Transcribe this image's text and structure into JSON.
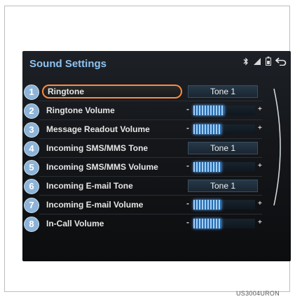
{
  "screen": {
    "title": "Sound Settings",
    "status_icons": [
      "bluetooth-icon",
      "signal-icon",
      "battery-icon",
      "back-icon"
    ],
    "accent_color": "#8fc3f0",
    "focus_color": "#ff8a40"
  },
  "items": [
    {
      "number": "1",
      "label": "Ringtone",
      "type": "tone",
      "value": "Tone 1",
      "focused": true
    },
    {
      "number": "2",
      "label": "Ringtone Volume",
      "type": "volume",
      "minus": "-",
      "plus": "+",
      "level": 0.5
    },
    {
      "number": "3",
      "label": "Message Readout Volume",
      "type": "volume",
      "minus": "-",
      "plus": "+",
      "level": 0.45
    },
    {
      "number": "4",
      "label": "Incoming SMS/MMS Tone",
      "type": "tone",
      "value": "Tone 1"
    },
    {
      "number": "5",
      "label": "Incoming SMS/MMS Volume",
      "type": "volume",
      "minus": "-",
      "plus": "+",
      "level": 0.45
    },
    {
      "number": "6",
      "label": "Incoming E-mail Tone",
      "type": "tone",
      "value": "Tone 1"
    },
    {
      "number": "7",
      "label": "Incoming E-mail Volume",
      "type": "volume",
      "minus": "-",
      "plus": "+",
      "level": 0.45
    },
    {
      "number": "8",
      "label": "In-Call Volume",
      "type": "volume",
      "minus": "-",
      "plus": "+",
      "level": 0.45
    }
  ],
  "caption": "US3004URON"
}
